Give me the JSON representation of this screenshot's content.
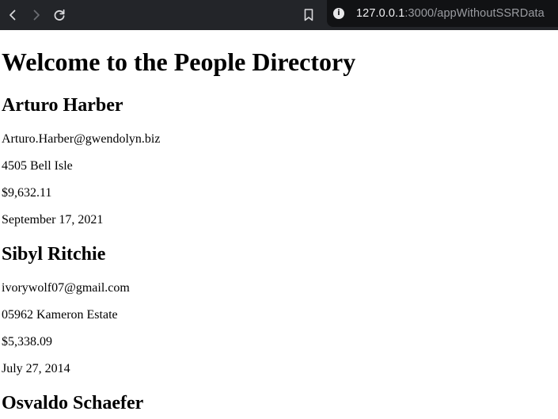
{
  "browser": {
    "url_host": "127.0.0.1",
    "url_rest": ":3000/appWithoutSSRData",
    "icons": {
      "back": "chevron-left-icon",
      "forward": "chevron-right-icon",
      "reload": "reload-icon",
      "bookmark": "bookmark-icon",
      "site_info": "info-icon"
    }
  },
  "page": {
    "title": "Welcome to the People Directory",
    "people": [
      {
        "name": "Arturo Harber",
        "email": "Arturo.Harber@gwendolyn.biz",
        "address": "4505 Bell Isle",
        "amount": "$9,632.11",
        "date": "September 17, 2021"
      },
      {
        "name": "Sibyl Ritchie",
        "email": "ivorywolf07@gmail.com",
        "address": "05962 Kameron Estate",
        "amount": "$5,338.09",
        "date": "July 27, 2014"
      },
      {
        "name": "Osvaldo Schaefer"
      }
    ]
  }
}
